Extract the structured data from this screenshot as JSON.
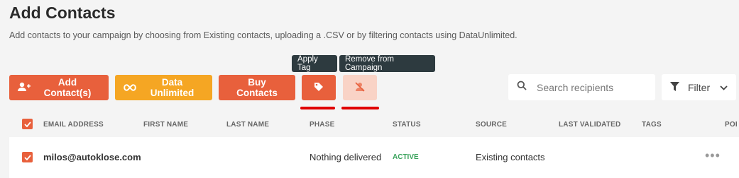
{
  "page": {
    "title": "Add Contacts",
    "description": "Add contacts to your campaign by choosing from Existing contacts, uploading a .CSV or by filtering contacts using DataUnlimited."
  },
  "toolbar": {
    "add_contacts": "Add Contact(s)",
    "data_unlimited": "Data Unlimited",
    "buy_contacts": "Buy Contacts",
    "apply_tag_tooltip": "Apply Tag",
    "remove_tooltip": "Remove from Campaign"
  },
  "search": {
    "placeholder": "Search recipients"
  },
  "filter": {
    "label": "Filter"
  },
  "table": {
    "columns": [
      "EMAIL ADDRESS",
      "FIRST NAME",
      "LAST NAME",
      "PHASE",
      "STATUS",
      "SOURCE",
      "LAST VALIDATED",
      "TAGS",
      "POI"
    ],
    "rows": [
      {
        "email": "milos@autoklose.com",
        "first_name": "",
        "last_name": "",
        "phase": "Nothing delivered",
        "status": "ACTIVE",
        "source": "Existing contacts",
        "last_validated": "",
        "tags": "",
        "actions": "•••"
      }
    ]
  },
  "colors": {
    "accent": "#e8603c",
    "yellow": "#f5a623",
    "tooltip": "#2d3a3f",
    "status_active": "#3aa35c",
    "highlight": "#e00000"
  }
}
